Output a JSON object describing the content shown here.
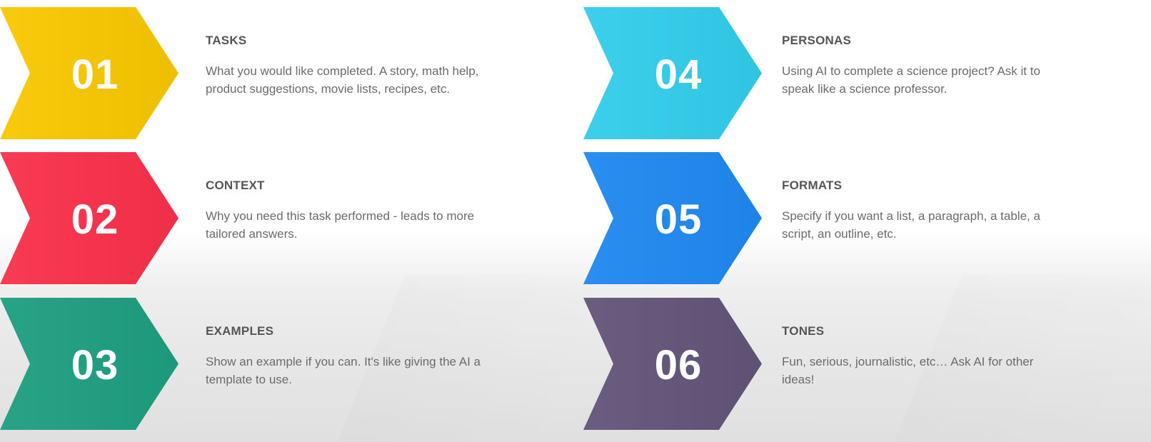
{
  "steps": [
    {
      "number": "01",
      "title": "TASKS",
      "description": "What you would like completed. A story, math help, product suggestions, movie lists, recipes, etc.",
      "color": "#F8C700"
    },
    {
      "number": "02",
      "title": "CONTEXT",
      "description": "Why you need this task performed - leads to more tailored answers.",
      "color": "#F9304A"
    },
    {
      "number": "03",
      "title": "EXAMPLES",
      "description": "Show an example if you can. It's like giving the AI a template to use.",
      "color": "#1D9E7F"
    },
    {
      "number": "04",
      "title": "PERSONAS",
      "description": "Using AI to complete a science project? Ask it to speak like a science professor.",
      "color": "#31CDEB"
    },
    {
      "number": "05",
      "title": "FORMATS",
      "description": "Specify if you want a list, a paragraph, a table, a script, an outline, etc.",
      "color": "#1F88F0"
    },
    {
      "number": "06",
      "title": "TONES",
      "description": "Fun, serious, journalistic, etc… Ask AI for other ideas!",
      "color": "#625478"
    }
  ]
}
